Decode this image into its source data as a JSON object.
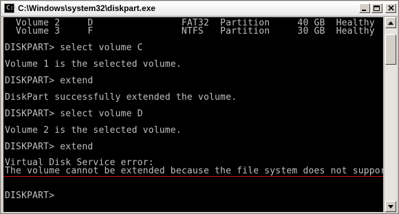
{
  "window": {
    "title": "C:\\Windows\\system32\\diskpart.exe",
    "icon": "console-icon"
  },
  "console": {
    "lines": [
      "  Volume 2     D                FAT32  Partition     40 GB  Healthy",
      "  Volume 3     F                NTFS   Partition     30 GB  Healthy",
      "",
      "DISKPART> select volume C",
      "",
      "Volume 1 is the selected volume.",
      "",
      "DISKPART> extend",
      "",
      "DiskPart successfully extended the volume.",
      "",
      "DISKPART> select volume D",
      "",
      "Volume 2 is the selected volume.",
      "",
      "DISKPART> extend",
      "",
      "Virtual Disk Service error:",
      "The volume cannot be extended because the file system does not suppor",
      "",
      "",
      "DISKPART>"
    ],
    "text_color": "#c0c0c0",
    "background": "#000000",
    "highlight_underline_color": "#d01010"
  }
}
